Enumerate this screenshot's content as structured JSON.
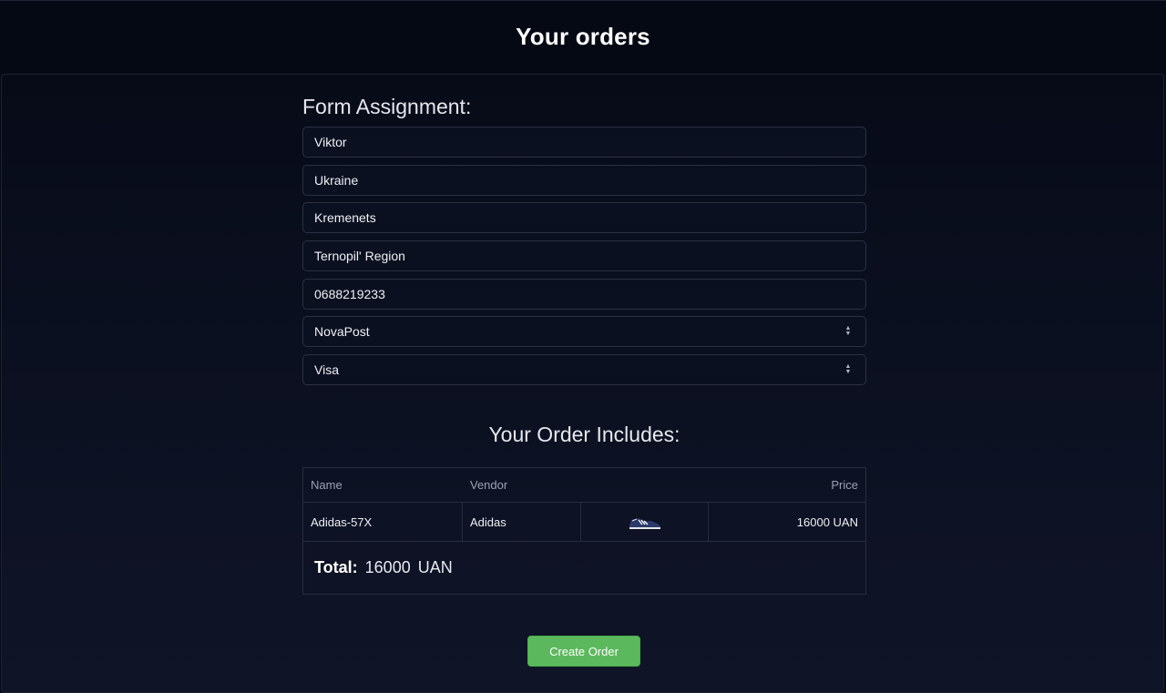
{
  "header": {
    "title": "Your orders"
  },
  "form": {
    "title": "Form Assignment:",
    "name": "Viktor",
    "country": "Ukraine",
    "city": "Kremenets",
    "region": "Ternopil' Region",
    "phone": "0688219233",
    "delivery": "NovaPost",
    "payment": "Visa"
  },
  "order": {
    "title": "Your Order Includes:",
    "columns": {
      "name": "Name",
      "vendor": "Vendor",
      "price": "Price"
    },
    "items": [
      {
        "name": "Adidas-57X",
        "vendor": "Adidas",
        "image_icon": "sneaker-icon",
        "price": "16000 UAN"
      }
    ],
    "total_label": "Total:",
    "total_value": "16000",
    "total_currency": "UAN"
  },
  "actions": {
    "create_order": "Create Order"
  },
  "colors": {
    "accent_green": "#5cb85c",
    "background": "#060a17"
  }
}
